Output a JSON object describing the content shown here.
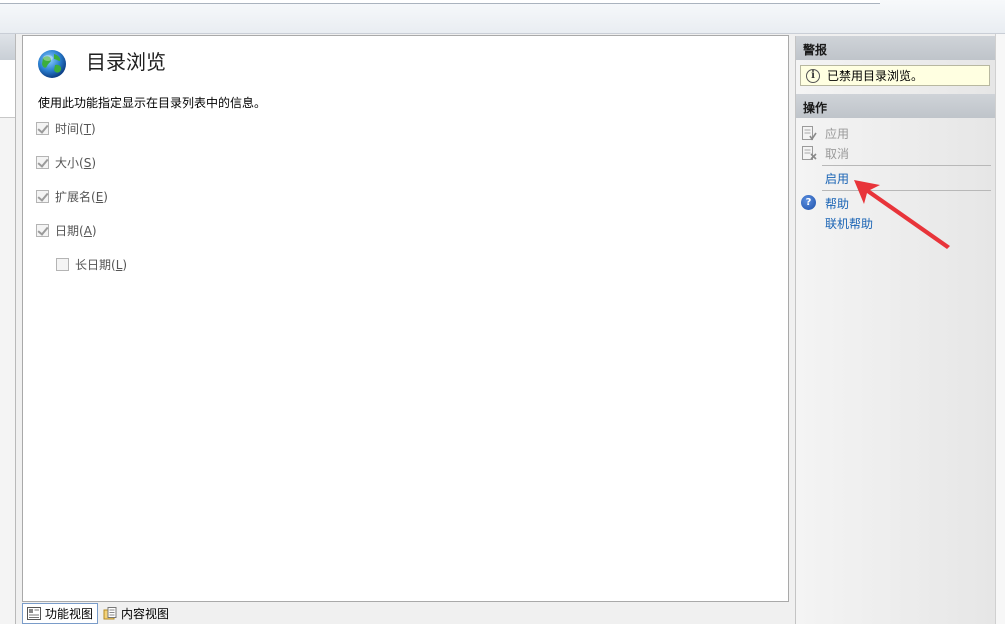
{
  "main": {
    "title": "目录浏览",
    "description": "使用此功能指定显示在目录列表中的信息。",
    "options": [
      {
        "text": "时间",
        "key": "T",
        "checked": true
      },
      {
        "text": "大小",
        "key": "S",
        "checked": true
      },
      {
        "text": "扩展名",
        "key": "E",
        "checked": true
      },
      {
        "text": "日期",
        "key": "A",
        "checked": true
      },
      {
        "text": "长日期",
        "key": "L",
        "checked": false
      }
    ]
  },
  "view_tabs": {
    "feature_view": "功能视图",
    "content_view": "内容视图"
  },
  "actions_pane": {
    "alerts_header": "警报",
    "alert_text": "已禁用目录浏览。",
    "actions_header": "操作",
    "apply": "应用",
    "cancel": "取消",
    "enable": "启用",
    "help": "帮助",
    "online_help": "联机帮助"
  },
  "colors": {
    "link": "#1a64b5",
    "disabled": "#9a9a9a",
    "alert_bg": "#ffffe1",
    "annotation_arrow": "#e8343a"
  }
}
